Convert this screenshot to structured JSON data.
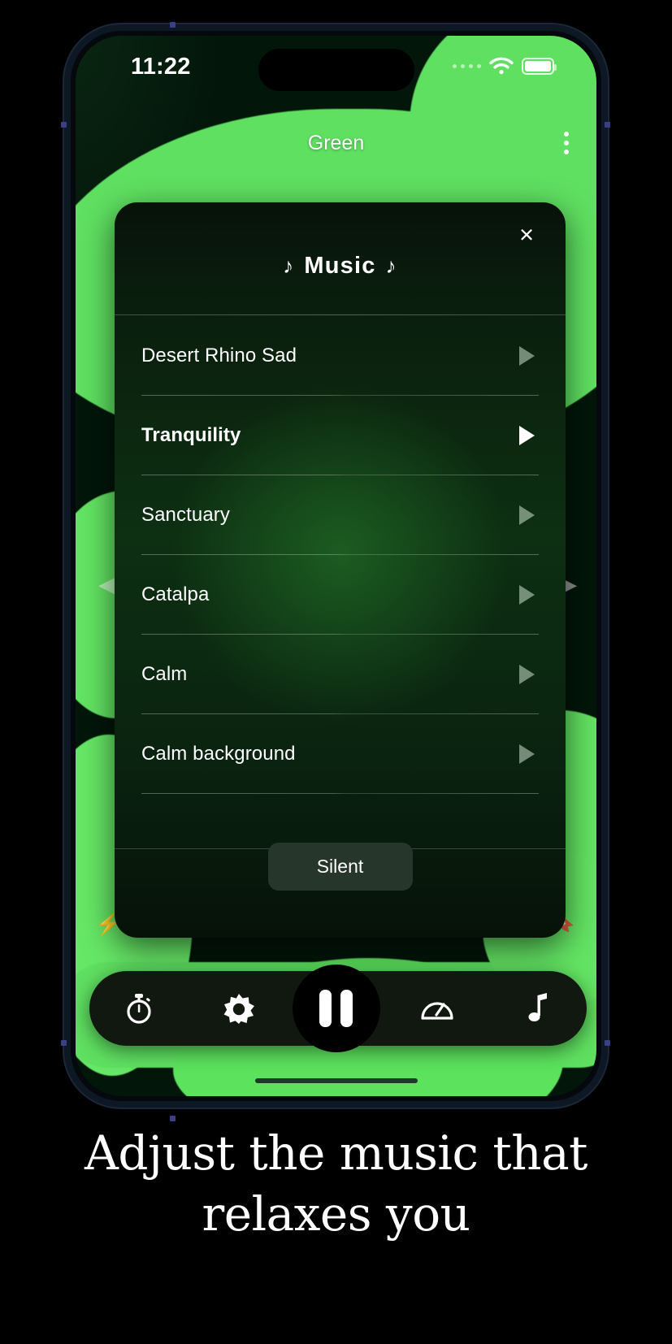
{
  "status_bar": {
    "time": "11:22",
    "signal_icon": "signal-dots-icon",
    "wifi_icon": "wifi-icon",
    "battery_icon": "battery-icon"
  },
  "app": {
    "title": "Green",
    "menu_icon": "kebab-menu-icon",
    "prev_icon": "chevron-left-icon",
    "next_icon": "chevron-right-icon",
    "bottom_left_icon": "flash-icon",
    "bottom_right_icon": "bookmark-icon"
  },
  "modal": {
    "title": "Music",
    "note_glyph": "♪",
    "close_label": "×",
    "tracks": [
      {
        "name": "Desert Rhino Sad",
        "selected": false
      },
      {
        "name": "Tranquility",
        "selected": true
      },
      {
        "name": "Sanctuary",
        "selected": false
      },
      {
        "name": "Catalpa",
        "selected": false
      },
      {
        "name": "Calm",
        "selected": false
      },
      {
        "name": "Calm background",
        "selected": false
      }
    ],
    "silent_label": "Silent"
  },
  "tabbar": {
    "items": [
      {
        "name": "timer",
        "icon": "stopwatch-icon"
      },
      {
        "name": "brightness",
        "icon": "brightness-sun-icon"
      },
      {
        "name": "play-pause",
        "icon": "pause-icon"
      },
      {
        "name": "speed",
        "icon": "speedometer-icon"
      },
      {
        "name": "music",
        "icon": "music-note-icon"
      }
    ]
  },
  "caption": {
    "line1": "Adjust the music that",
    "line2": "relaxes you"
  },
  "colors": {
    "accent_green": "#5fe061",
    "background": "#000000",
    "modal_green": "#0d2f12",
    "silent_button": "#27362a"
  }
}
